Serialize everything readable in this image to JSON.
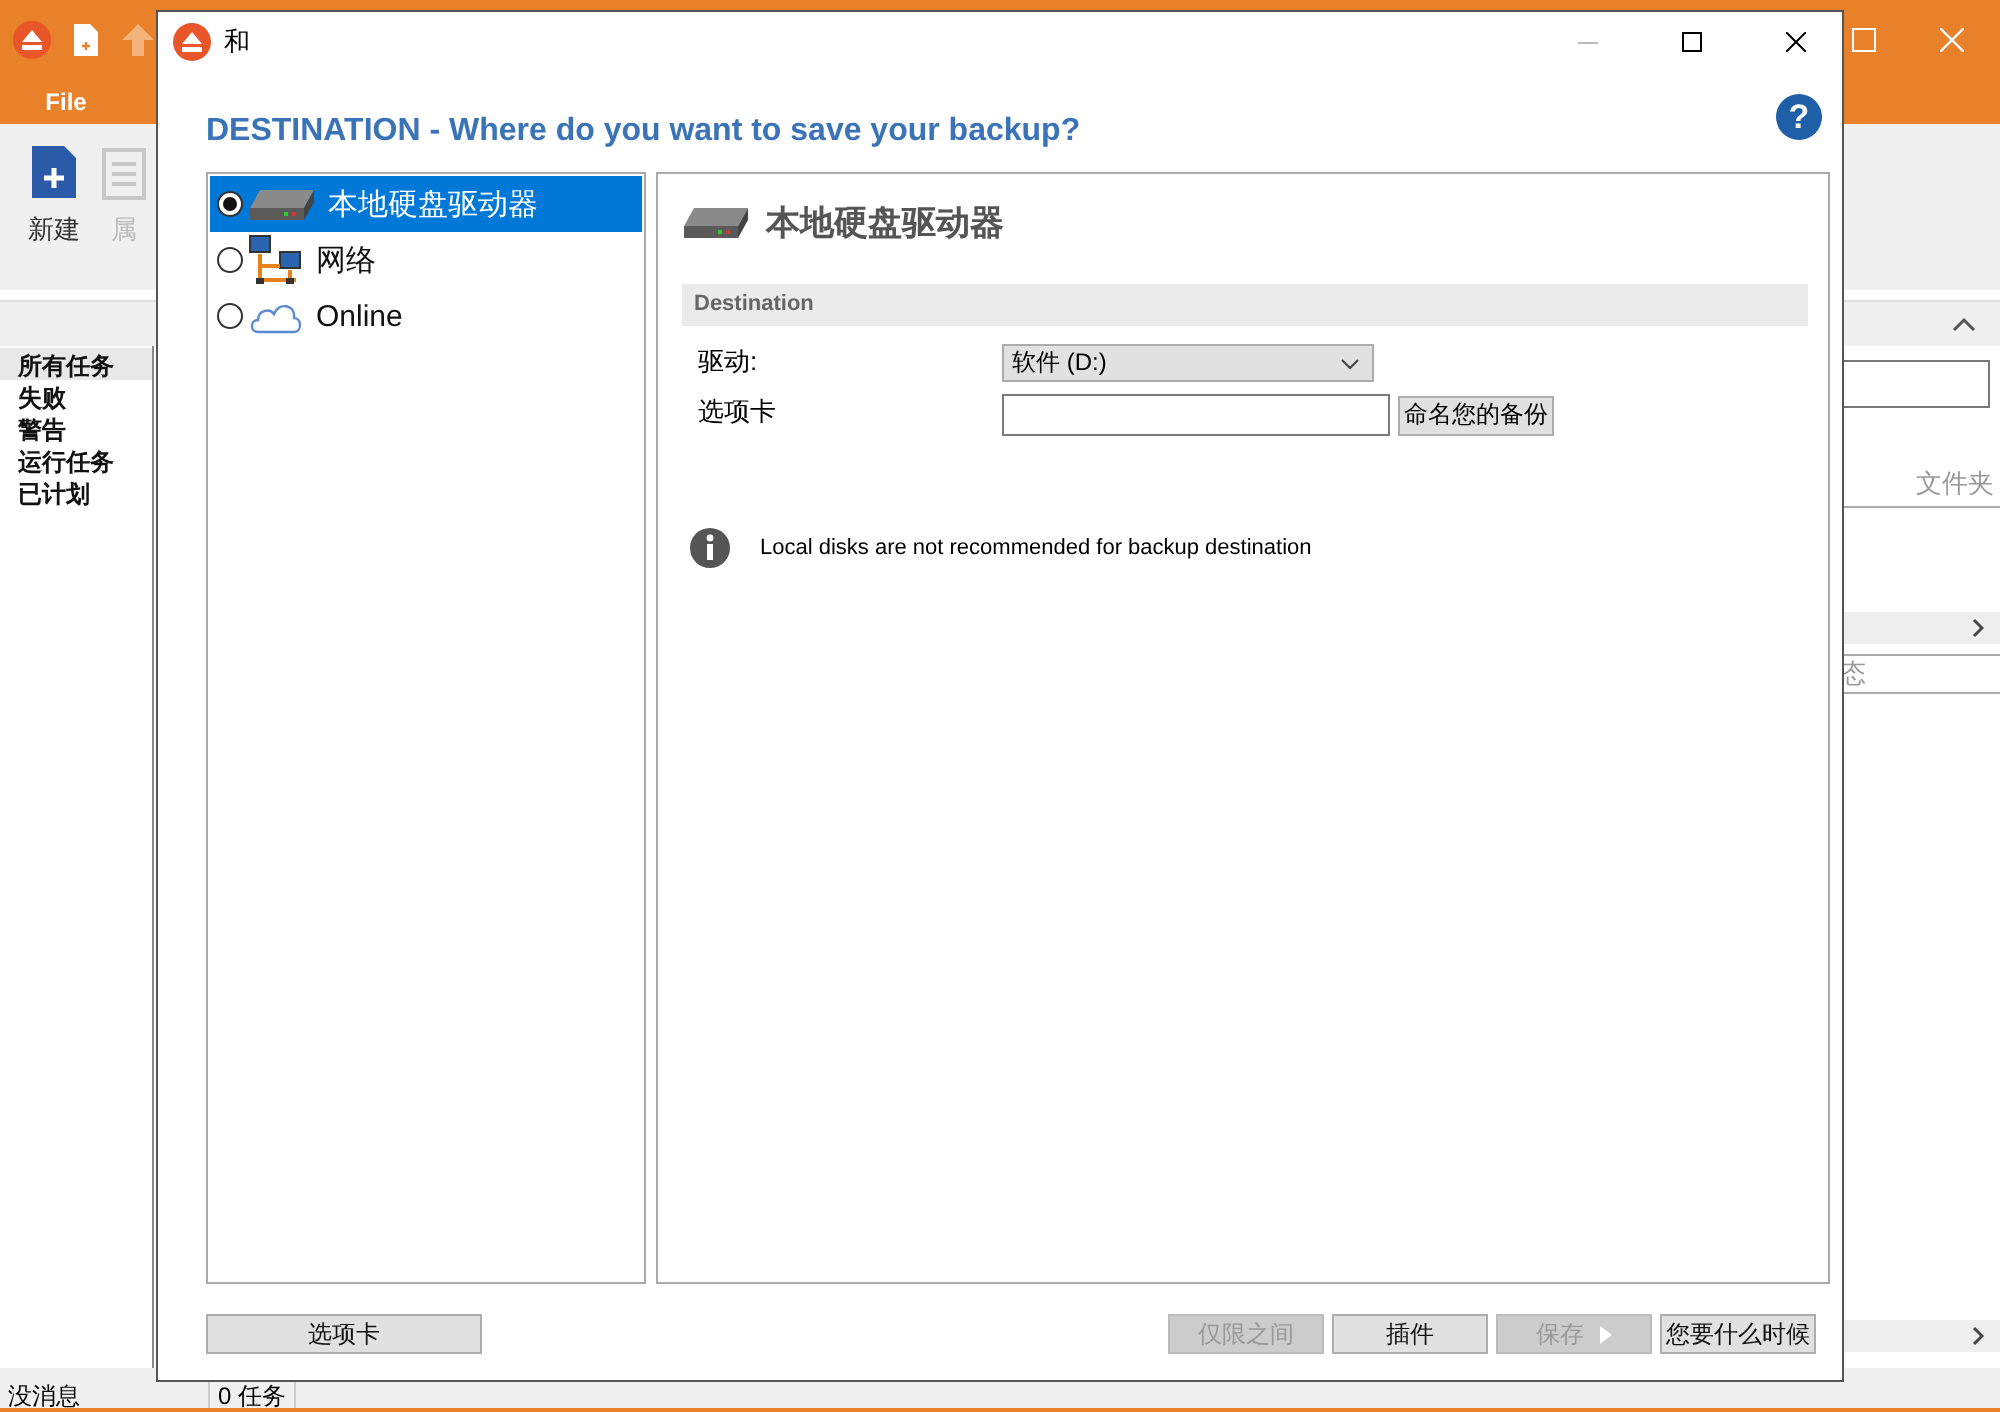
{
  "app": {
    "file_tab": "File",
    "ribbon": [
      {
        "label": "新建",
        "kind": "new"
      },
      {
        "label": "属",
        "kind": "properties"
      }
    ],
    "filters": [
      {
        "label": "所有任务",
        "selected": true
      },
      {
        "label": "失败",
        "selected": false
      },
      {
        "label": "警告",
        "selected": false
      },
      {
        "label": "运行任务",
        "selected": false
      },
      {
        "label": "已计划",
        "selected": false
      }
    ],
    "right_panel": {
      "column_1": "文件夹",
      "column_2": "态"
    },
    "status_bar": [
      "没消息",
      "0 任务"
    ]
  },
  "dialog": {
    "title": "和",
    "heading": "DESTINATION - Where do you want to save your backup?",
    "help": "?",
    "destinations": [
      {
        "label": "本地硬盘驱动器",
        "kind": "disk",
        "selected": true
      },
      {
        "label": "网络",
        "kind": "network",
        "selected": false
      },
      {
        "label": "Online",
        "kind": "cloud",
        "selected": false
      }
    ],
    "panel_title": "本地硬盘驱动器",
    "section": "Destination",
    "fields": [
      {
        "label": "驱动:",
        "kind": "select",
        "value": "软件 (D:)"
      },
      {
        "label": "选项卡",
        "kind": "text",
        "button": "命名您的备份"
      }
    ],
    "info": "Local disks are not recommended for backup destination",
    "left_button": {
      "label": "选项卡",
      "disabled": false
    },
    "buttons": [
      {
        "label": "仅限之间",
        "disabled": true,
        "kind": "plain"
      },
      {
        "label": "插件",
        "disabled": false,
        "kind": "plain"
      },
      {
        "label": "保存",
        "disabled": true,
        "kind": "next"
      },
      {
        "label": "您要什么时候",
        "disabled": false,
        "kind": "plain"
      }
    ]
  }
}
